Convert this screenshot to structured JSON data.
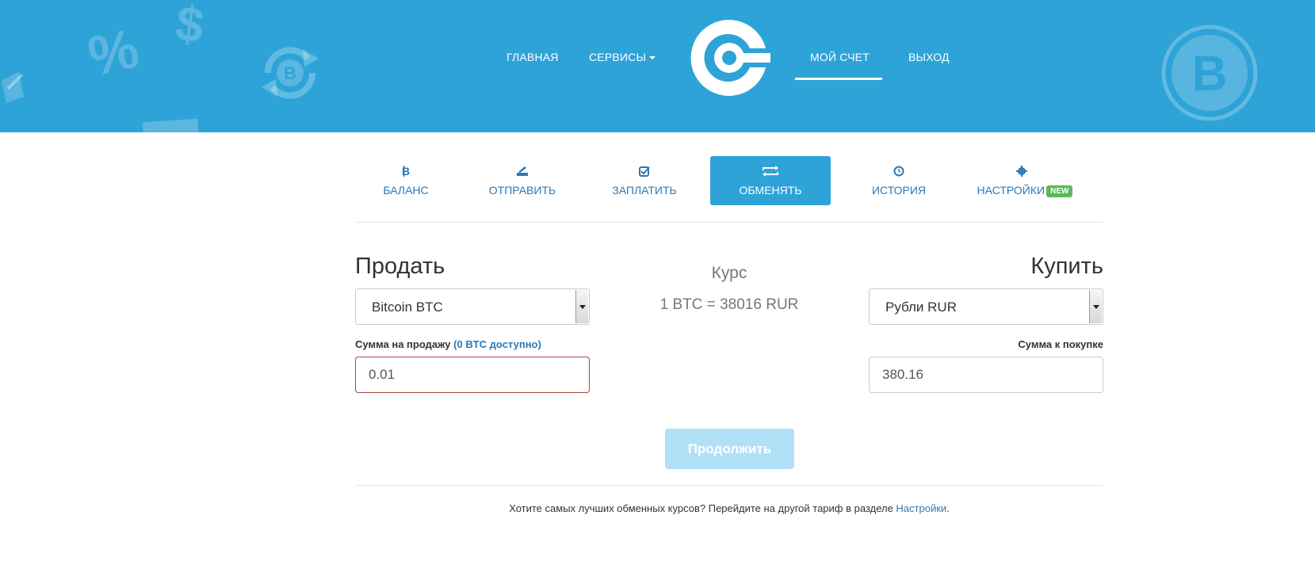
{
  "nav": {
    "home": "ГЛАВНАЯ",
    "services": "СЕРВИСЫ",
    "my_account": "МОЙ СЧЕТ",
    "logout": "ВЫХОД"
  },
  "background_icons": {
    "percent": "%",
    "dollar": "$",
    "bitcoin": "B"
  },
  "tabs": [
    {
      "label": "БАЛАНС",
      "icon": "bitcoin-icon"
    },
    {
      "label": "ОТПРАВИТЬ",
      "icon": "send-icon"
    },
    {
      "label": "ЗАПЛАТИТЬ",
      "icon": "checkbox-icon"
    },
    {
      "label": "ОБМЕНЯТЬ",
      "icon": "exchange-icon",
      "active": true
    },
    {
      "label": "ИСТОРИЯ",
      "icon": "clock-icon"
    },
    {
      "label": "НАСТРОЙКИ",
      "icon": "gear-icon",
      "badge": "NEW"
    }
  ],
  "exchange": {
    "sell_heading": "Продать",
    "buy_heading": "Купить",
    "sell_currency": "Bitcoin BTC",
    "buy_currency": "Рубли RUR",
    "rate_title": "Курс",
    "rate_value": "1 BTC = 38016 RUR",
    "sell_amount_label": "Сумма на продажу",
    "sell_available": "(0 BTC доступно)",
    "buy_amount_label": "Сумма к покупке",
    "sell_amount_value": "0.01",
    "buy_amount_value": "380.16",
    "continue_button": "Продолжить"
  },
  "footer": {
    "note_text": "Хотите самых лучших обменных курсов? Перейдите на другой тариф в разделе ",
    "note_link": "Настройки",
    "note_end": "."
  },
  "colors": {
    "header_bg": "#2ea3d8",
    "link": "#2f78b3",
    "badge": "#5cb85c",
    "button_disabled": "#b0e0f5"
  }
}
